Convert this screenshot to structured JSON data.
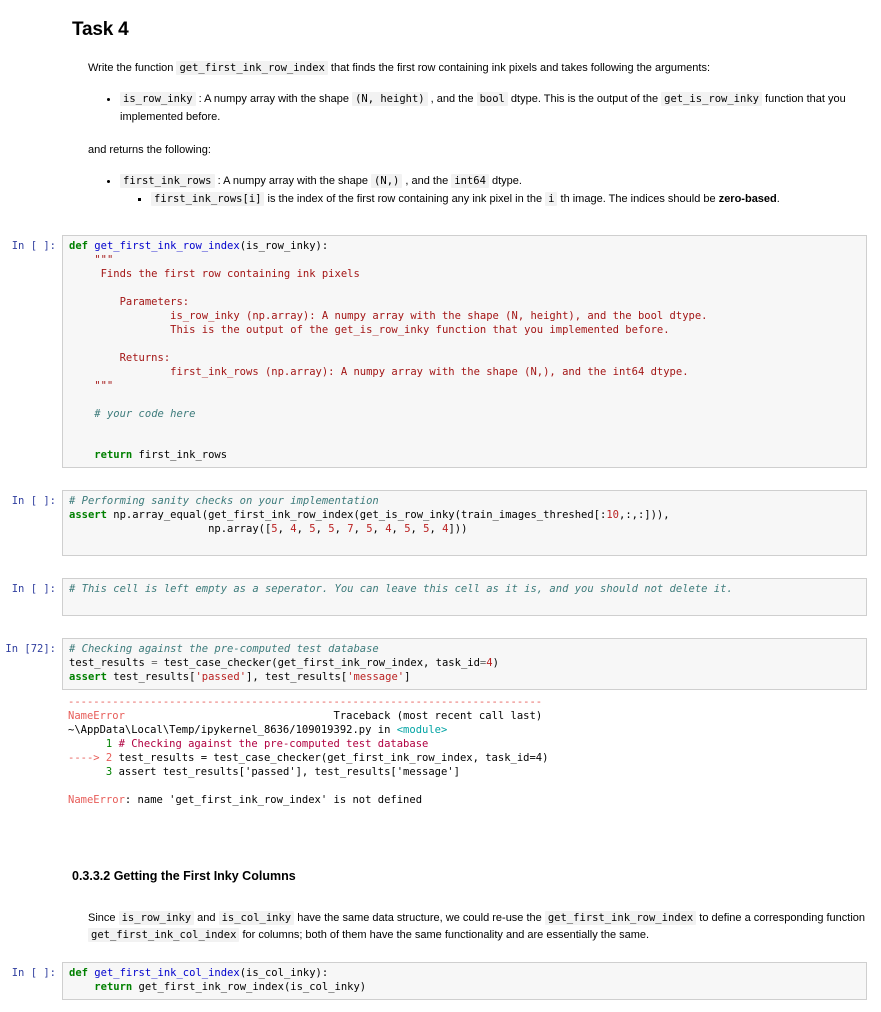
{
  "task": {
    "heading": "Task 4",
    "intro_before": "Write the function ",
    "intro_code": "get_first_ink_row_index",
    "intro_after": " that finds the first row containing ink pixels and takes following the arguments:",
    "args": [
      {
        "name": "is_row_inky",
        "t1": " : A numpy array with the shape ",
        "shape": "(N, height)",
        "t2": " , and the ",
        "dtype": "bool",
        "t3": " dtype. This is the output of the ",
        "ref": "get_is_row_inky",
        "t4": " function that you implemented before."
      }
    ],
    "returns_label": "and returns the following:",
    "returns": [
      {
        "name": "first_ink_rows",
        "t1": " : A numpy array with the shape ",
        "shape": "(N,)",
        "t2": " , and the ",
        "dtype": "int64",
        "t3": " dtype."
      }
    ],
    "returns_sub": {
      "code": "first_ink_rows[i]",
      "t1": " is the index of the first row containing any ink pixel in the ",
      "idx": "i",
      "t2": " th image. The indices should be ",
      "strong": "zero-based",
      "t3": "."
    }
  },
  "cells": [
    {
      "prompt": "In [ ]:",
      "source": "def get_first_ink_row_index(is_row_inky):\n    \"\"\"\n     Finds the first row containing ink pixels\n\n        Parameters:\n                is_row_inky (np.array): A numpy array with the shape (N, height), and the bool dtype.\n                This is the output of the get_is_row_inky function that you implemented before.\n\n        Returns:\n                first_ink_rows (np.array): A numpy array with the shape (N,), and the int64 dtype.\n    \"\"\"\n\n    # your code here\n\n\n    return first_ink_rows"
    },
    {
      "prompt": "In [ ]:",
      "source": "# Performing sanity checks on your implementation\nassert np.array_equal(get_first_ink_row_index(get_is_row_inky(train_images_threshed[:10,:,:])),\n                      np.array([5, 4, 5, 5, 7, 5, 4, 5, 5, 4]))"
    },
    {
      "prompt": "In [ ]:",
      "source": "# This cell is left empty as a seperator. You can leave this cell as it is, and you should not delete it."
    },
    {
      "prompt": "In [72]:",
      "source": "# Checking against the pre-computed test database\ntest_results = test_case_checker(get_first_ink_row_index, task_id=4)\nassert test_results['passed'], test_results['message']"
    },
    {
      "prompt": "In [ ]:",
      "source": "def get_first_ink_col_index(is_col_inky):\n    return get_first_ink_row_index(is_col_inky)"
    }
  ],
  "traceback": {
    "rule": "---------------------------------------------------------------------------",
    "error_name": "NameError",
    "error_title": "Traceback (most recent call last)",
    "file_path": "~\\AppData\\Local\\Temp/ipykernel_8636/109019392.py in ",
    "file_scope": "<module>",
    "line1_no": "      1 ",
    "line1_code": "# Checking against the pre-computed test database",
    "line2_arrow": "----> 2 ",
    "line2_code": "test_results = test_case_checker(get_first_ink_row_index, task_id=4)",
    "line3_no": "      3 ",
    "line3_code": "assert test_results['passed'], test_results['message']",
    "final_error_name": "NameError",
    "final_error_msg": ": name 'get_first_ink_row_index' is not defined"
  },
  "section2": {
    "heading": "0.3.3.2 Getting the First Inky Columns",
    "p1_a": "Since ",
    "p1_c1": "is_row_inky",
    "p1_b": " and ",
    "p1_c2": "is_col_inky",
    "p1_c": " have the same data structure, we could re-use the ",
    "p1_c3": "get_first_ink_row_index",
    "p1_d": " to define a corresponding function",
    "p2_c1": "get_first_ink_col_index",
    "p2_a": " for columns; both of them have the same functionality and are essentially the same."
  },
  "colors": {
    "cell_bg": "#f7f7f7",
    "cell_border": "#cfcfcf",
    "prompt": "#303F9F",
    "keyword": "#008000",
    "function": "#0000CD",
    "string": "#BA2121",
    "comment": "#3D7B7B",
    "error": "#E75C58",
    "inline_code_bg": "#f2f2f2"
  }
}
